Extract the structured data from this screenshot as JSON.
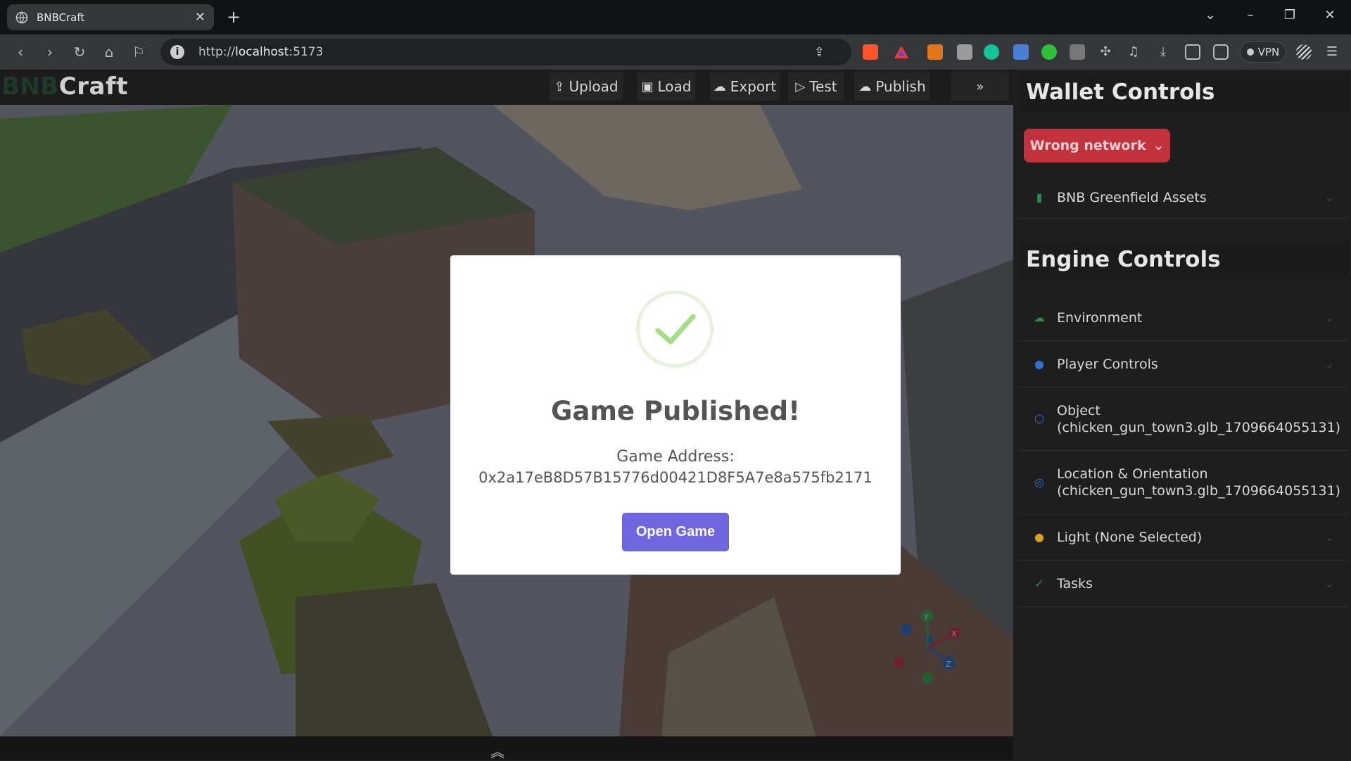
{
  "browser": {
    "tab_title": "BNBCraft",
    "tab_close": "✕",
    "new_tab": "+",
    "url_host": "localhost",
    "url_prefix": "http://",
    "url_port": ":5173",
    "vpn_label": "VPN"
  },
  "app": {
    "logo_bnb": "BNB",
    "logo_craft": "Craft",
    "toolbar": {
      "upload": "Upload",
      "load": "Load",
      "export": "Export",
      "test": "Test",
      "publish": "Publish"
    }
  },
  "panel": {
    "wallet_title": "Wallet Controls",
    "wrong_network": "Wrong network",
    "greenfield_assets": "BNB Greenfield Assets",
    "engine_title": "Engine Controls",
    "items": {
      "environment": "Environment",
      "player_controls": "Player Controls",
      "object_line1": "Object",
      "object_line2": "(chicken_gun_town3.glb_1709664055131)",
      "location_line1": "Location & Orientation",
      "location_line2": "(chicken_gun_town3.glb_1709664055131)",
      "light": "Light (None Selected)",
      "tasks": "Tasks"
    }
  },
  "modal": {
    "title": "Game Published!",
    "address_label": "Game Address:",
    "address": "0x2a17eB8D57B15776d00421D8F5A7e8a575fb2171",
    "open_button": "Open Game"
  },
  "gizmo": {
    "x": "X",
    "y": "Y",
    "z": "Z"
  },
  "colors": {
    "accent_button": "#7066e0",
    "wrong_network": "#c2323d",
    "success_check": "#a5dc86"
  }
}
